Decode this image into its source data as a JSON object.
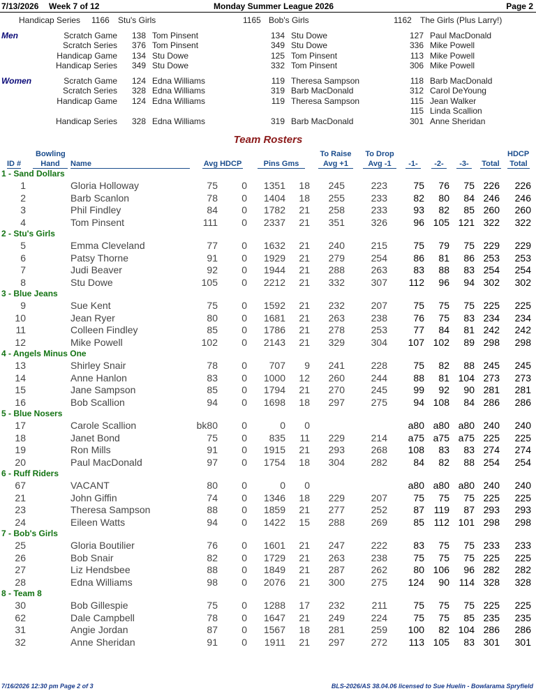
{
  "header": {
    "date": "7/13/2026",
    "week": "Week 7 of 12",
    "title": "Monday Summer League 2026",
    "page": "Page 2"
  },
  "handicap_series": {
    "label": "Handicap Series",
    "entries": [
      {
        "score": "1166",
        "team": "Stu's Girls"
      },
      {
        "score": "1165",
        "team": "Bob's Girls"
      },
      {
        "score": "1162",
        "team": "The Girls (Plus Larry!)"
      }
    ]
  },
  "high_scores": {
    "men": {
      "label": "Men",
      "rows": [
        {
          "cat": "Scratch Game",
          "e": [
            [
              "138",
              "Tom Pinsent"
            ],
            [
              "134",
              "Stu Dowe"
            ],
            [
              "127",
              "Paul MacDonald"
            ]
          ]
        },
        {
          "cat": "Scratch Series",
          "e": [
            [
              "376",
              "Tom Pinsent"
            ],
            [
              "349",
              "Stu Dowe"
            ],
            [
              "336",
              "Mike Powell"
            ]
          ]
        },
        {
          "cat": "Handicap Game",
          "e": [
            [
              "134",
              "Stu Dowe"
            ],
            [
              "125",
              "Tom Pinsent"
            ],
            [
              "113",
              "Mike Powell"
            ]
          ]
        },
        {
          "cat": "Handicap Series",
          "e": [
            [
              "349",
              "Stu Dowe"
            ],
            [
              "332",
              "Tom Pinsent"
            ],
            [
              "306",
              "Mike Powell"
            ]
          ]
        }
      ]
    },
    "women": {
      "label": "Women",
      "rows": [
        {
          "cat": "Scratch Game",
          "e": [
            [
              "124",
              "Edna Williams"
            ],
            [
              "119",
              "Theresa Sampson"
            ],
            [
              "118",
              "Barb MacDonald"
            ]
          ]
        },
        {
          "cat": "Scratch Series",
          "e": [
            [
              "328",
              "Edna Williams"
            ],
            [
              "319",
              "Barb MacDonald"
            ],
            [
              "312",
              "Carol DeYoung"
            ]
          ]
        },
        {
          "cat": "Handicap Game",
          "e": [
            [
              "124",
              "Edna Williams"
            ],
            [
              "119",
              "Theresa Sampson"
            ],
            [
              "115",
              "Jean Walker"
            ]
          ]
        },
        {
          "cat": "",
          "e": [
            [
              "",
              ""
            ],
            [
              "",
              ""
            ],
            [
              "115",
              "Linda Scallion"
            ]
          ]
        },
        {
          "cat": "Handicap Series",
          "e": [
            [
              "328",
              "Edna Williams"
            ],
            [
              "319",
              "Barb MacDonald"
            ],
            [
              "301",
              "Anne Sheridan"
            ]
          ]
        }
      ]
    }
  },
  "rosters": {
    "title": "Team Rosters",
    "columns": {
      "id": "ID #",
      "bowling": "Bowling",
      "hand": "Hand",
      "name": "Name",
      "avg_hdcp": "Avg HDCP",
      "pins_gms": "Pins  Gms",
      "to_raise": "To Raise",
      "avg_plus": "Avg +1",
      "to_drop": "To Drop",
      "avg_minus": "Avg -1",
      "g1": "-1-",
      "g2": "-2-",
      "g3": "-3-",
      "total": "Total",
      "hdcp": "HDCP",
      "hdcp_total": "Total"
    },
    "teams": [
      {
        "name": "1 - Sand Dollars",
        "players": [
          [
            "1",
            "Gloria Holloway",
            "75",
            "0",
            "1351",
            "18",
            "245",
            "223",
            "75",
            "76",
            "75",
            "226",
            "226"
          ],
          [
            "2",
            "Barb Scanlon",
            "78",
            "0",
            "1404",
            "18",
            "255",
            "233",
            "82",
            "80",
            "84",
            "246",
            "246"
          ],
          [
            "3",
            "Phil Findley",
            "84",
            "0",
            "1782",
            "21",
            "258",
            "233",
            "93",
            "82",
            "85",
            "260",
            "260"
          ],
          [
            "4",
            "Tom Pinsent",
            "111",
            "0",
            "2337",
            "21",
            "351",
            "326",
            "96",
            "105",
            "121",
            "322",
            "322"
          ]
        ]
      },
      {
        "name": "2 - Stu's Girls",
        "players": [
          [
            "5",
            "Emma Cleveland",
            "77",
            "0",
            "1632",
            "21",
            "240",
            "215",
            "75",
            "79",
            "75",
            "229",
            "229"
          ],
          [
            "6",
            "Patsy Thorne",
            "91",
            "0",
            "1929",
            "21",
            "279",
            "254",
            "86",
            "81",
            "86",
            "253",
            "253"
          ],
          [
            "7",
            "Judi Beaver",
            "92",
            "0",
            "1944",
            "21",
            "288",
            "263",
            "83",
            "88",
            "83",
            "254",
            "254"
          ],
          [
            "8",
            "Stu Dowe",
            "105",
            "0",
            "2212",
            "21",
            "332",
            "307",
            "112",
            "96",
            "94",
            "302",
            "302"
          ]
        ]
      },
      {
        "name": "3 - Blue Jeans",
        "players": [
          [
            "9",
            "Sue Kent",
            "75",
            "0",
            "1592",
            "21",
            "232",
            "207",
            "75",
            "75",
            "75",
            "225",
            "225"
          ],
          [
            "10",
            "Jean Ryer",
            "80",
            "0",
            "1681",
            "21",
            "263",
            "238",
            "76",
            "75",
            "83",
            "234",
            "234"
          ],
          [
            "11",
            "Colleen Findley",
            "85",
            "0",
            "1786",
            "21",
            "278",
            "253",
            "77",
            "84",
            "81",
            "242",
            "242"
          ],
          [
            "12",
            "Mike Powell",
            "102",
            "0",
            "2143",
            "21",
            "329",
            "304",
            "107",
            "102",
            "89",
            "298",
            "298"
          ]
        ]
      },
      {
        "name": "4 - Angels Minus One",
        "players": [
          [
            "13",
            "Shirley Snair",
            "78",
            "0",
            "707",
            "9",
            "241",
            "228",
            "75",
            "82",
            "88",
            "245",
            "245"
          ],
          [
            "14",
            "Anne Hanlon",
            "83",
            "0",
            "1000",
            "12",
            "260",
            "244",
            "88",
            "81",
            "104",
            "273",
            "273"
          ],
          [
            "15",
            "Jane Sampson",
            "85",
            "0",
            "1794",
            "21",
            "270",
            "245",
            "99",
            "92",
            "90",
            "281",
            "281"
          ],
          [
            "16",
            "Bob Scallion",
            "94",
            "0",
            "1698",
            "18",
            "297",
            "275",
            "94",
            "108",
            "84",
            "286",
            "286"
          ]
        ]
      },
      {
        "name": "5 - Blue Nosers",
        "players": [
          [
            "17",
            "Carole Scallion",
            "bk80",
            "0",
            "0",
            "0",
            "",
            "",
            "a80",
            "a80",
            "a80",
            "240",
            "240"
          ],
          [
            "18",
            "Janet Bond",
            "75",
            "0",
            "835",
            "11",
            "229",
            "214",
            "a75",
            "a75",
            "a75",
            "225",
            "225"
          ],
          [
            "19",
            "Ron Mills",
            "91",
            "0",
            "1915",
            "21",
            "293",
            "268",
            "108",
            "83",
            "83",
            "274",
            "274"
          ],
          [
            "20",
            "Paul MacDonald",
            "97",
            "0",
            "1754",
            "18",
            "304",
            "282",
            "84",
            "82",
            "88",
            "254",
            "254"
          ]
        ]
      },
      {
        "name": "6 - Ruff Riders",
        "players": [
          [
            "67",
            "VACANT",
            "80",
            "0",
            "0",
            "0",
            "",
            "",
            "a80",
            "a80",
            "a80",
            "240",
            "240"
          ],
          [
            "21",
            "John Giffin",
            "74",
            "0",
            "1346",
            "18",
            "229",
            "207",
            "75",
            "75",
            "75",
            "225",
            "225"
          ],
          [
            "23",
            "Theresa Sampson",
            "88",
            "0",
            "1859",
            "21",
            "277",
            "252",
            "87",
            "119",
            "87",
            "293",
            "293"
          ],
          [
            "24",
            "Eileen Watts",
            "94",
            "0",
            "1422",
            "15",
            "288",
            "269",
            "85",
            "112",
            "101",
            "298",
            "298"
          ]
        ]
      },
      {
        "name": "7 - Bob's Girls",
        "players": [
          [
            "25",
            "Gloria Boutilier",
            "76",
            "0",
            "1601",
            "21",
            "247",
            "222",
            "83",
            "75",
            "75",
            "233",
            "233"
          ],
          [
            "26",
            "Bob Snair",
            "82",
            "0",
            "1729",
            "21",
            "263",
            "238",
            "75",
            "75",
            "75",
            "225",
            "225"
          ],
          [
            "27",
            "Liz Hendsbee",
            "88",
            "0",
            "1849",
            "21",
            "287",
            "262",
            "80",
            "106",
            "96",
            "282",
            "282"
          ],
          [
            "28",
            "Edna Williams",
            "98",
            "0",
            "2076",
            "21",
            "300",
            "275",
            "124",
            "90",
            "114",
            "328",
            "328"
          ]
        ]
      },
      {
        "name": "8 - Team 8",
        "players": [
          [
            "30",
            "Bob Gillespie",
            "75",
            "0",
            "1288",
            "17",
            "232",
            "211",
            "75",
            "75",
            "75",
            "225",
            "225"
          ],
          [
            "62",
            "Dale Campbell",
            "78",
            "0",
            "1647",
            "21",
            "249",
            "224",
            "75",
            "75",
            "85",
            "235",
            "235"
          ],
          [
            "31",
            "Angie Jordan",
            "87",
            "0",
            "1567",
            "18",
            "281",
            "259",
            "100",
            "82",
            "104",
            "286",
            "286"
          ],
          [
            "32",
            "Anne Sheridan",
            "91",
            "0",
            "1911",
            "21",
            "297",
            "272",
            "113",
            "105",
            "83",
            "301",
            "301"
          ]
        ]
      }
    ]
  },
  "footer": {
    "left": "7/16/2026  12:30 pm  Page 2 of 3",
    "right": "BLS-2026/AS 38.04.06 licensed to Sue Huelin - Bowlarama Spryfield"
  }
}
